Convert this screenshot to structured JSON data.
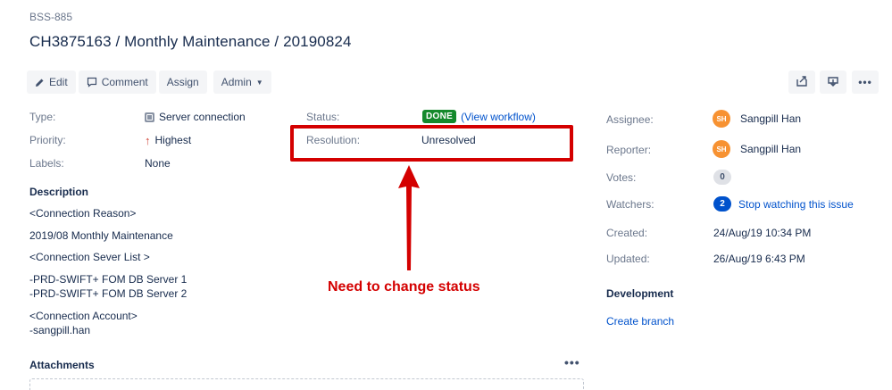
{
  "issue": {
    "key": "BSS-885",
    "title": "CH3875163 / Monthly Maintenance / 20190824"
  },
  "toolbar": {
    "edit_label": "Edit",
    "comment_label": "Comment",
    "assign_label": "Assign",
    "admin_label": "Admin"
  },
  "details": {
    "type_label": "Type:",
    "type_value": "Server connection",
    "priority_label": "Priority:",
    "priority_value": "Highest",
    "labels_label": "Labels:",
    "labels_value": "None",
    "status_label": "Status:",
    "status_value": "DONE",
    "view_workflow": "(View workflow)",
    "resolution_label": "Resolution:",
    "resolution_value": "Unresolved"
  },
  "description": {
    "title": "Description",
    "lines": [
      "<Connection Reason>",
      "2019/08 Monthly Maintenance",
      "<Connection Sever List >",
      "-PRD-SWIFT+ FOM DB Server 1\n-PRD-SWIFT+ FOM DB Server 2",
      "<Connection Account>\n-sangpill.han"
    ]
  },
  "attachments": {
    "title": "Attachments",
    "more": "•••"
  },
  "people": {
    "assignee_label": "Assignee:",
    "assignee_initials": "SH",
    "assignee_name": "Sangpill Han",
    "reporter_label": "Reporter:",
    "reporter_initials": "SH",
    "reporter_name": "Sangpill Han",
    "votes_label": "Votes:",
    "votes_count": "0",
    "watchers_label": "Watchers:",
    "watchers_count": "2",
    "watch_link": "Stop watching this issue"
  },
  "dates": {
    "created_label": "Created:",
    "created_value": "24/Aug/19 10:34 PM",
    "updated_label": "Updated:",
    "updated_value": "26/Aug/19 6:43 PM"
  },
  "development": {
    "title": "Development",
    "create_branch": "Create branch"
  },
  "annotation": {
    "text": "Need to change status"
  },
  "colors": {
    "done_green": "#14892c",
    "annotation_red": "#d40000",
    "link_blue": "#0052cc",
    "avatar_orange": "#f79232"
  }
}
